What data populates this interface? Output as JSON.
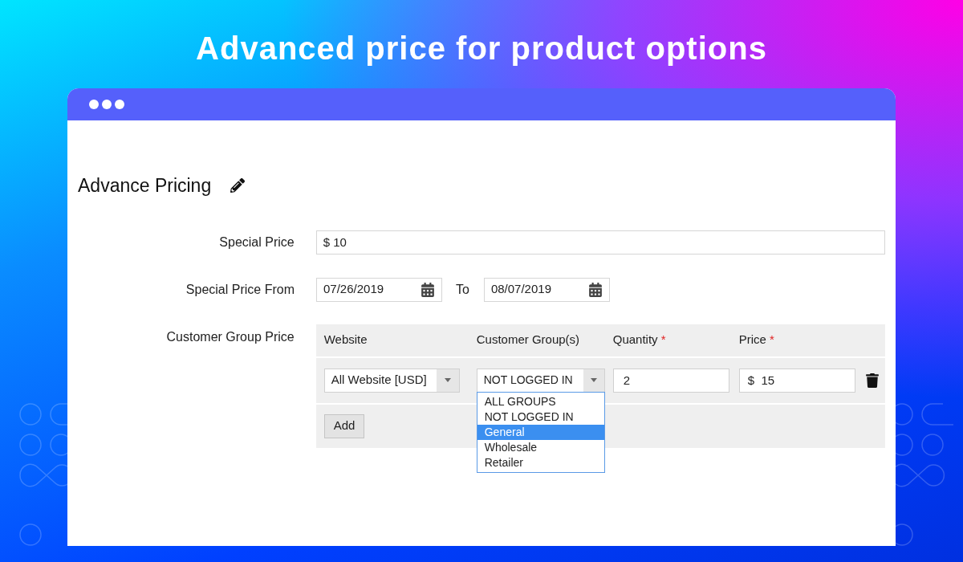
{
  "banner": {
    "title": "Advanced price for product options"
  },
  "section": {
    "title": "Advance Pricing"
  },
  "special_price": {
    "label": "Special Price",
    "value": "$ 10"
  },
  "special_price_from": {
    "label": "Special Price From",
    "from": "07/26/2019",
    "to_label": "To",
    "to": "08/07/2019"
  },
  "customer_group_price": {
    "label": "Customer Group Price",
    "columns": [
      {
        "label": "Website"
      },
      {
        "label": "Customer Group(s)"
      },
      {
        "label": "Quantity",
        "required_mark": "*"
      },
      {
        "label": "Price",
        "required_mark": "*"
      }
    ],
    "rows": [
      {
        "website": "All Website [USD]",
        "customer_group": "NOT LOGGED IN",
        "quantity": "2",
        "price": "$  15"
      }
    ],
    "dropdown": {
      "expanded": true,
      "options": [
        {
          "label": "ALL GROUPS",
          "selected": false
        },
        {
          "label": "NOT LOGGED IN",
          "selected": false
        },
        {
          "label": "General",
          "selected": true
        },
        {
          "label": "Wholesale",
          "selected": false
        },
        {
          "label": "Retailer",
          "selected": false
        }
      ]
    },
    "add_button": "Add"
  }
}
